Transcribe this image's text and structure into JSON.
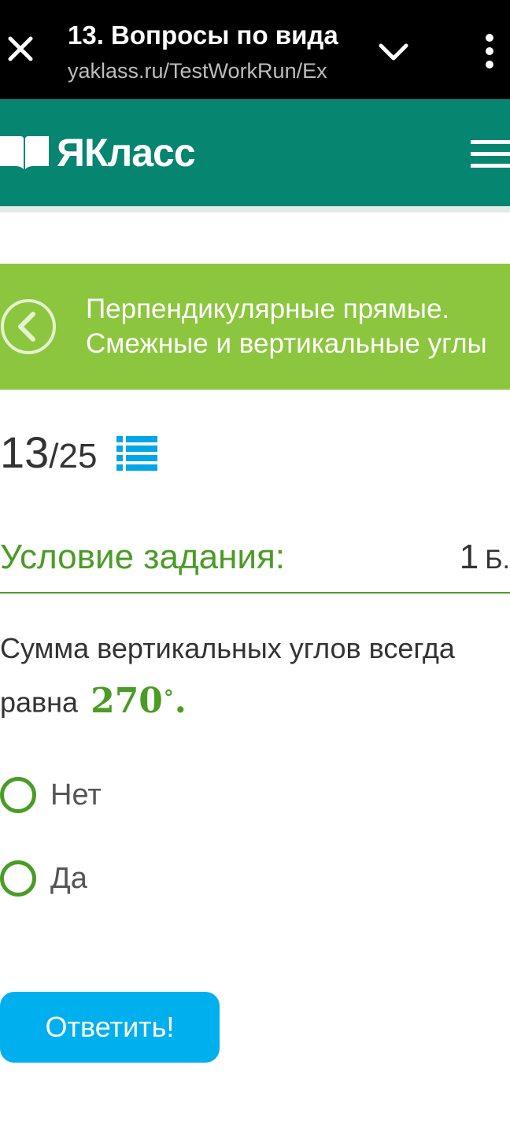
{
  "tab": {
    "title": "13. Вопросы по вида",
    "url": "yaklass.ru/TestWorkRun/Ex",
    "close_icon": "close-icon",
    "chevron_icon": "chevron-down-icon",
    "menu_icon": "more-vert-icon"
  },
  "header": {
    "logo_text": "ЯКласс",
    "logo_icon": "book-icon",
    "menu_icon": "hamburger-menu-icon",
    "brand_color": "#068571"
  },
  "banner": {
    "back_icon": "back-circle-icon",
    "topic_line1": "Перпендикулярные прямые.",
    "topic_line2": "Смежные и вертикальные углы",
    "color": "#8cc63e"
  },
  "progress": {
    "current": "13",
    "separator": "/",
    "total": "25",
    "list_icon": "list-icon"
  },
  "task": {
    "condition_label": "Условие задания:",
    "points": "1",
    "points_unit": "Б.",
    "question_text": "Сумма вертикальных углов всегда",
    "question_text2": "равна",
    "math_value": "270",
    "math_degree": "∘",
    "math_end": "."
  },
  "options": [
    {
      "label": "Нет",
      "selected": false
    },
    {
      "label": "Да",
      "selected": false
    }
  ],
  "submit": {
    "label": "Ответить!",
    "color": "#00b0ee"
  }
}
